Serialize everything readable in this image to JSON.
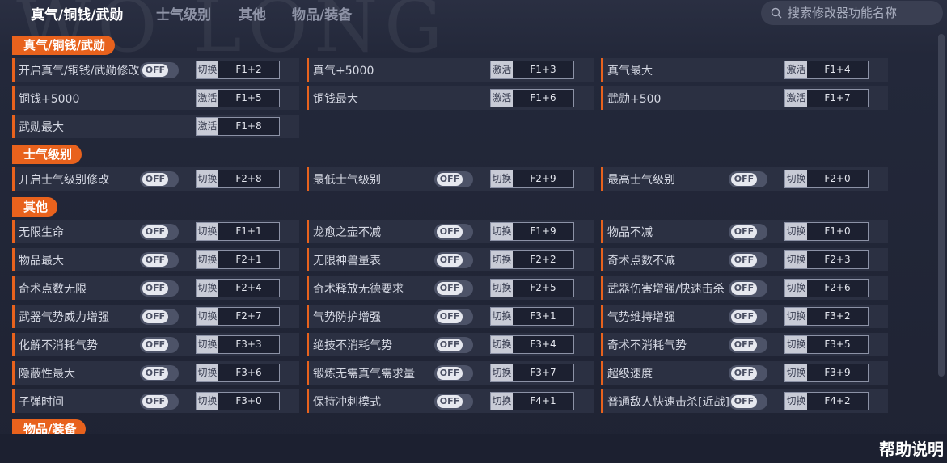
{
  "nav": {
    "tabs": [
      "真气/铜钱/武勋",
      "士气级别",
      "其他",
      "物品/装备"
    ],
    "active": 0
  },
  "search": {
    "placeholder": "搜索修改器功能名称"
  },
  "help_label": "帮助说明",
  "watermark": "WO LONG",
  "toggle_off_label": "OFF",
  "colors": {
    "accent": "#e8621d",
    "row_bg": "#2b3042",
    "page_bg": "#1f2333"
  },
  "sections": [
    {
      "title": "真气/铜钱/武勋",
      "items": [
        {
          "label": "开启真气/铜钱/武勋修改",
          "toggle": true,
          "action": "切换",
          "hotkey": "F1+2"
        },
        {
          "label": "真气+5000",
          "toggle": false,
          "action": "激活",
          "hotkey": "F1+3"
        },
        {
          "label": "真气最大",
          "toggle": false,
          "action": "激活",
          "hotkey": "F1+4"
        },
        {
          "label": "铜钱+5000",
          "toggle": false,
          "action": "激活",
          "hotkey": "F1+5"
        },
        {
          "label": "铜钱最大",
          "toggle": false,
          "action": "激活",
          "hotkey": "F1+6"
        },
        {
          "label": "武勋+500",
          "toggle": false,
          "action": "激活",
          "hotkey": "F1+7"
        },
        {
          "label": "武勋最大",
          "toggle": false,
          "action": "激活",
          "hotkey": "F1+8"
        }
      ]
    },
    {
      "title": "士气级别",
      "items": [
        {
          "label": "开启士气级别修改",
          "toggle": true,
          "action": "切换",
          "hotkey": "F2+8"
        },
        {
          "label": "最低士气级别",
          "toggle": true,
          "action": "切换",
          "hotkey": "F2+9"
        },
        {
          "label": "最高士气级别",
          "toggle": true,
          "action": "切换",
          "hotkey": "F2+0"
        }
      ]
    },
    {
      "title": "其他",
      "items": [
        {
          "label": "无限生命",
          "toggle": true,
          "action": "切换",
          "hotkey": "F1+1"
        },
        {
          "label": "龙愈之壶不减",
          "toggle": true,
          "action": "切换",
          "hotkey": "F1+9"
        },
        {
          "label": "物品不减",
          "toggle": true,
          "action": "切换",
          "hotkey": "F1+0"
        },
        {
          "label": "物品最大",
          "toggle": true,
          "action": "切换",
          "hotkey": "F2+1"
        },
        {
          "label": "无限神兽量表",
          "toggle": true,
          "action": "切换",
          "hotkey": "F2+2"
        },
        {
          "label": "奇术点数不减",
          "toggle": true,
          "action": "切换",
          "hotkey": "F2+3"
        },
        {
          "label": "奇术点数无限",
          "toggle": true,
          "action": "切换",
          "hotkey": "F2+4"
        },
        {
          "label": "奇术释放无德要求",
          "toggle": true,
          "action": "切换",
          "hotkey": "F2+5"
        },
        {
          "label": "武器伤害增强/快速击杀",
          "toggle": true,
          "action": "切换",
          "hotkey": "F2+6"
        },
        {
          "label": "武器气势威力增强",
          "toggle": true,
          "action": "切换",
          "hotkey": "F2+7"
        },
        {
          "label": "气势防护增强",
          "toggle": true,
          "action": "切换",
          "hotkey": "F3+1"
        },
        {
          "label": "气势维持增强",
          "toggle": true,
          "action": "切换",
          "hotkey": "F3+2"
        },
        {
          "label": "化解不消耗气势",
          "toggle": true,
          "action": "切换",
          "hotkey": "F3+3"
        },
        {
          "label": "绝技不消耗气势",
          "toggle": true,
          "action": "切换",
          "hotkey": "F3+4"
        },
        {
          "label": "奇术不消耗气势",
          "toggle": true,
          "action": "切换",
          "hotkey": "F3+5"
        },
        {
          "label": "隐蔽性最大",
          "toggle": true,
          "action": "切换",
          "hotkey": "F3+6"
        },
        {
          "label": "锻炼无需真气需求量",
          "toggle": true,
          "action": "切换",
          "hotkey": "F3+7"
        },
        {
          "label": "超级速度",
          "toggle": true,
          "action": "切换",
          "hotkey": "F3+9"
        },
        {
          "label": "子弹时间",
          "toggle": true,
          "action": "切换",
          "hotkey": "F3+0"
        },
        {
          "label": "保持冲刺模式",
          "toggle": true,
          "action": "切换",
          "hotkey": "F4+1"
        },
        {
          "label": "普通敌人快速击杀[近战]",
          "toggle": true,
          "action": "切换",
          "hotkey": "F4+2"
        }
      ]
    },
    {
      "title": "物品/装备",
      "items": []
    }
  ]
}
